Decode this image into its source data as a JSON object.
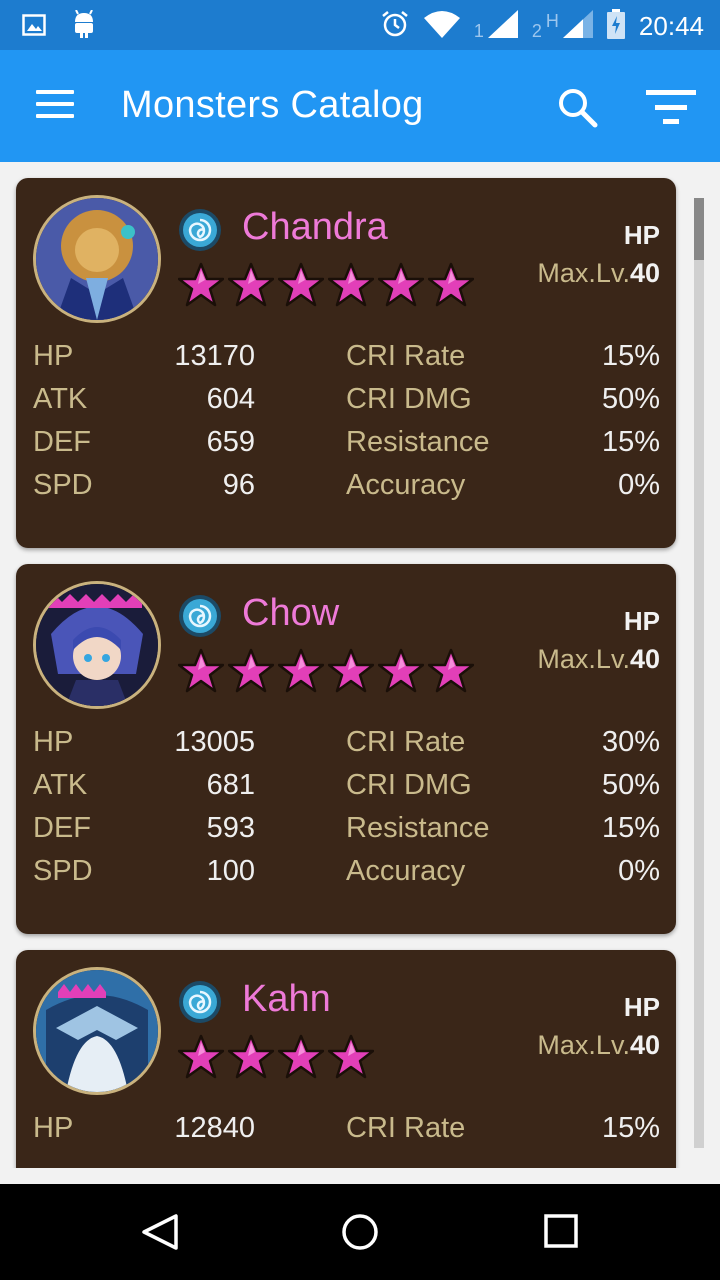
{
  "status_bar": {
    "time": "20:44",
    "sim1_label": "1",
    "sim2_label": "2",
    "network_type": "H",
    "left_icons": [
      "image-icon",
      "android-icon"
    ],
    "right_icons": [
      "alarm-icon",
      "wifi-icon",
      "signal-icon",
      "signal-icon",
      "battery-charging-icon"
    ]
  },
  "app_bar": {
    "title": "Monsters Catalog",
    "menu_icon": "hamburger-menu-icon",
    "search_icon": "search-icon",
    "filter_icon": "filter-icon"
  },
  "monsters": [
    {
      "name": "Chandra",
      "attribute": "wind",
      "stars": 6,
      "type": "HP",
      "max_lv_label": "Max.Lv.",
      "max_lv": "40",
      "stats": [
        {
          "label": "HP",
          "value": "13170",
          "label2": "CRI Rate",
          "value2": "15%"
        },
        {
          "label": "ATK",
          "value": "604",
          "label2": "CRI DMG",
          "value2": "50%"
        },
        {
          "label": "DEF",
          "value": "659",
          "label2": "Resistance",
          "value2": "15%"
        },
        {
          "label": "SPD",
          "value": "96",
          "label2": "Accuracy",
          "value2": "0%"
        }
      ]
    },
    {
      "name": "Chow",
      "attribute": "wind",
      "stars": 6,
      "type": "HP",
      "max_lv_label": "Max.Lv.",
      "max_lv": "40",
      "stats": [
        {
          "label": "HP",
          "value": "13005",
          "label2": "CRI Rate",
          "value2": "30%"
        },
        {
          "label": "ATK",
          "value": "681",
          "label2": "CRI DMG",
          "value2": "50%"
        },
        {
          "label": "DEF",
          "value": "593",
          "label2": "Resistance",
          "value2": "15%"
        },
        {
          "label": "SPD",
          "value": "100",
          "label2": "Accuracy",
          "value2": "0%"
        }
      ]
    },
    {
      "name": "Kahn",
      "attribute": "wind",
      "stars": 4,
      "type": "HP",
      "max_lv_label": "Max.Lv.",
      "max_lv": "40",
      "stats": [
        {
          "label": "HP",
          "value": "12840",
          "label2": "CRI Rate",
          "value2": "15%"
        }
      ]
    }
  ],
  "nav_bar": {
    "icons": [
      "back-icon",
      "home-icon",
      "recents-icon"
    ]
  },
  "colors": {
    "status_bar": "#1d7ccf",
    "app_bar": "#2196f3",
    "card_background": "#3a2618",
    "monster_name": "#ee7ad8",
    "stat_label": "#c9ba8c",
    "stat_value": "#efefef",
    "star": "#e23fb8"
  }
}
